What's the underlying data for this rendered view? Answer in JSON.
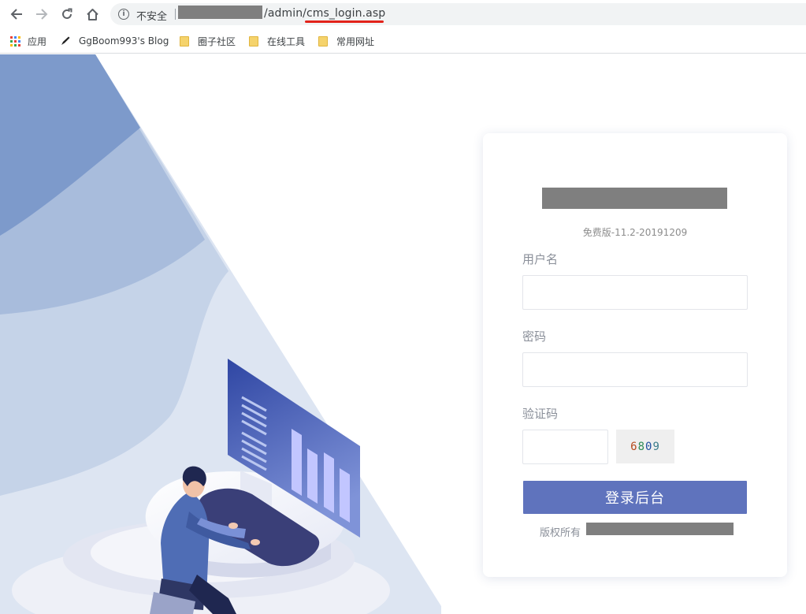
{
  "browser": {
    "security_label": "不安全",
    "url_path": "/admin/cms_login.asp"
  },
  "bookmarks": [
    {
      "label": "应用",
      "icon": "apps-grid-icon"
    },
    {
      "label": "GgBoom993's Blog",
      "icon": "pen-icon"
    },
    {
      "label": "圈子社区",
      "icon": "folder-icon"
    },
    {
      "label": "在线工具",
      "icon": "folder-icon"
    },
    {
      "label": "常用网址",
      "icon": "folder-icon"
    }
  ],
  "login": {
    "version": "免费版-11.2-20191209",
    "username_label": "用户名",
    "username_value": "",
    "password_label": "密码",
    "password_value": "",
    "captcha_label": "验证码",
    "captcha_value": "",
    "captcha_code": [
      "6",
      "8",
      "0",
      "9"
    ],
    "captcha_colors": [
      "#b54a1c",
      "#2e8b57",
      "#1f4fa0",
      "#3a7d8c"
    ],
    "submit_label": "登录后台",
    "copyright_prefix": "版权所有"
  },
  "colors": {
    "accent": "#5f73bd",
    "url_highlight": "#e2231a"
  }
}
